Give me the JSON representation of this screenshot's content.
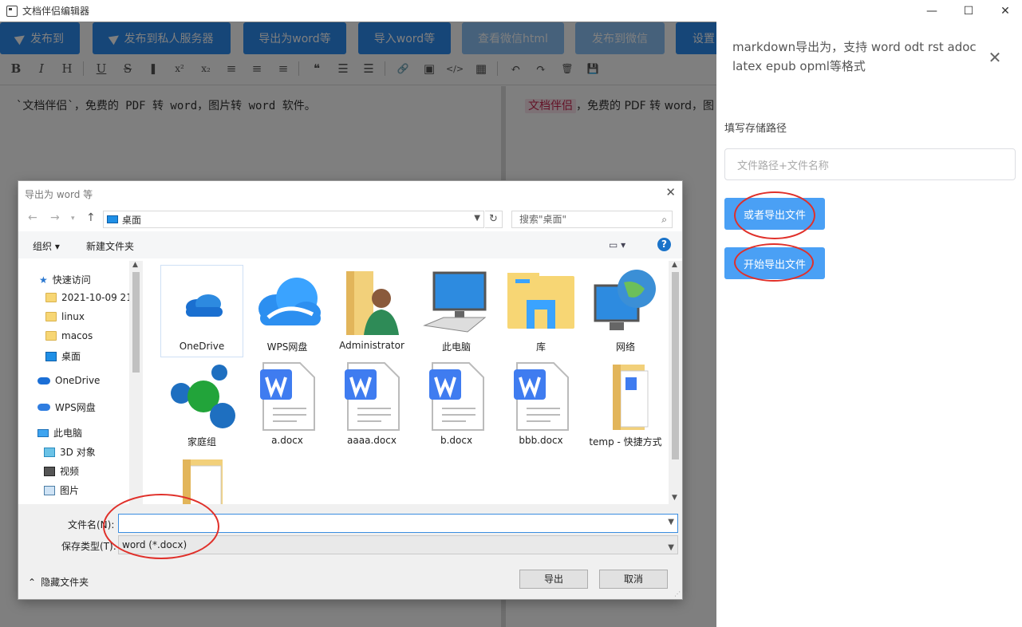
{
  "window": {
    "title": "文档伴侣编辑器"
  },
  "toolbar": {
    "buttons": [
      {
        "label": "发布到",
        "icon": "paper-plane-icon"
      },
      {
        "label": "发布到私人服务器",
        "icon": "paper-plane-icon"
      },
      {
        "label": "导出为word等"
      },
      {
        "label": "导入word等"
      },
      {
        "label": "查看微信html",
        "disabled": true
      },
      {
        "label": "发布到微信",
        "disabled": true
      },
      {
        "label": "设置"
      }
    ],
    "format_icons": [
      "B",
      "I",
      "H",
      "U",
      "S",
      "❚",
      "x²",
      "x₂",
      "≡",
      "≡",
      "≡",
      "❝",
      "☰",
      "☰",
      "🔗",
      "▣",
      "</>",
      "▦",
      "↶",
      "↷",
      "🗑",
      "💾"
    ]
  },
  "editor": {
    "left_text": "`文档伴侣`，免费的 PDF 转 word，图片转 word 软件。",
    "right_code": "文档伴侣",
    "right_text": "，免费的 PDF 转 word，图"
  },
  "drawer": {
    "header": "markdown导出为，支持 word odt rst adoc latex epub opml等格式",
    "label": "填写存储路径",
    "input_placeholder": "文件路径+文件名称",
    "btn_alt": "或者导出文件",
    "btn_start": "开始导出文件"
  },
  "dialog": {
    "title": "导出为 word 等",
    "address": "桌面",
    "search_placeholder": "搜索\"桌面\"",
    "organize": "组织 ▾",
    "new_folder": "新建文件夹",
    "nav": [
      {
        "label": "快速访问",
        "icon": "star"
      },
      {
        "label": "2021-10-09 21.",
        "icon": "folder"
      },
      {
        "label": "linux",
        "icon": "folder"
      },
      {
        "label": "macos",
        "icon": "folder"
      },
      {
        "label": "桌面",
        "icon": "desk"
      },
      {
        "label": "OneDrive",
        "icon": "cloud"
      },
      {
        "label": "WPS网盘",
        "icon": "cloud"
      },
      {
        "label": "此电脑",
        "icon": "pc"
      },
      {
        "label": "3D 对象",
        "icon": "cube"
      },
      {
        "label": "视频",
        "icon": "film"
      },
      {
        "label": "图片",
        "icon": "pic"
      }
    ],
    "files": [
      {
        "name": "OneDrive",
        "kind": "onedrive"
      },
      {
        "name": "WPS网盘",
        "kind": "wps"
      },
      {
        "name": "Administrator",
        "kind": "user"
      },
      {
        "name": "此电脑",
        "kind": "pc"
      },
      {
        "name": "库",
        "kind": "library"
      },
      {
        "name": "网络",
        "kind": "network"
      },
      {
        "name": "家庭组",
        "kind": "homegroup"
      },
      {
        "name": "a.docx",
        "kind": "docx"
      },
      {
        "name": "aaaa.docx",
        "kind": "docx"
      },
      {
        "name": "b.docx",
        "kind": "docx"
      },
      {
        "name": "bbb.docx",
        "kind": "docx"
      },
      {
        "name": "temp - 快捷方式",
        "kind": "shortcut"
      },
      {
        "name": "",
        "kind": "folder"
      }
    ],
    "filename_label": "文件名(N):",
    "filename_value": "",
    "type_label": "保存类型(T):",
    "type_value": "word (*.docx)",
    "hide_folders": "隐藏文件夹",
    "save": "导出",
    "cancel": "取消"
  }
}
